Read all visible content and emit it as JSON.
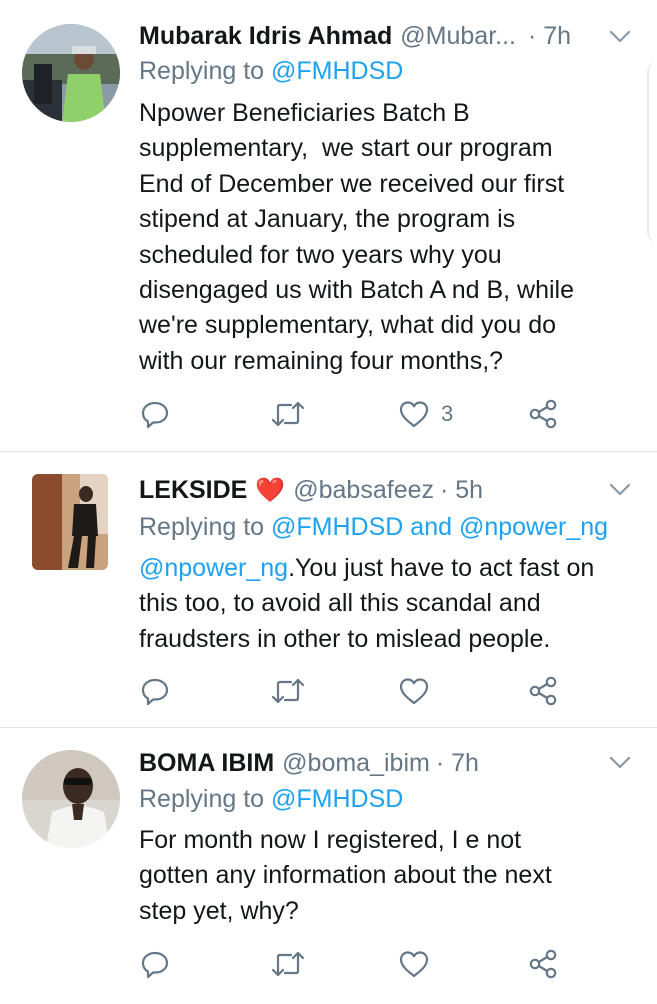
{
  "tweets": [
    {
      "name": "Mubarak Idris Ahmad",
      "handle": "@Mubar...",
      "time": "· 7h",
      "reply_prefix": "Replying to ",
      "reply_to": "@FMHDSD",
      "text_lines": [
        "Npower Beneficiaries Batch B",
        "supplementary,  we start our program",
        "End of December we received our first",
        "stipend at January, the program is",
        "scheduled for two years why you",
        "disengaged us with Batch A nd B, while",
        "we're supplementary, what did you do",
        "with our remaining four months,?"
      ],
      "like_count": "3"
    },
    {
      "name": "LEKSIDE",
      "name_emoji": "❤️",
      "handle": "@babsafeez",
      "time": "· 5h",
      "reply_prefix": "Replying to ",
      "reply_to": "@FMHDSD and @npower_ng",
      "text_mention": "@npower_ng",
      "text_lines": [
        ".You just have to act fast on",
        "this too, to avoid all this scandal and",
        "fraudsters in other to mislead people."
      ],
      "like_count": ""
    },
    {
      "name": "BOMA IBIM",
      "handle": "@boma_ibim",
      "time": "· 7h",
      "reply_prefix": "Replying to ",
      "reply_to": "@FMHDSD",
      "text_lines": [
        "For month now I registered, I e not",
        "gotten any information about the next",
        "step yet, why?"
      ],
      "like_count": ""
    }
  ],
  "icons": {
    "reply": "reply-icon",
    "retweet": "retweet-icon",
    "like": "heart-icon",
    "share": "share-icon",
    "more": "chevron-down-icon"
  },
  "colors": {
    "text": "#14171a",
    "muted": "#657786",
    "link": "#1da1f2",
    "divider": "#e1e8ed"
  }
}
